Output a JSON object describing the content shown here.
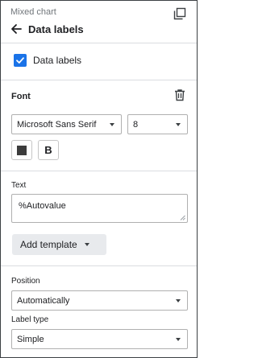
{
  "header": {
    "breadcrumb": "Mixed chart",
    "title": "Data labels"
  },
  "data_labels_toggle": {
    "label": "Data labels",
    "checked": true,
    "color": "#1a73e8"
  },
  "font": {
    "section_title": "Font",
    "family": "Microsoft Sans Serif",
    "size": "8",
    "text_color": "#3c3c3c",
    "bold_label": "B"
  },
  "text": {
    "label": "Text",
    "value": "%Autovalue"
  },
  "add_template": {
    "label": "Add template"
  },
  "position": {
    "label": "Position",
    "value": "Automatically"
  },
  "label_type": {
    "label": "Label type",
    "value": "Simple"
  }
}
